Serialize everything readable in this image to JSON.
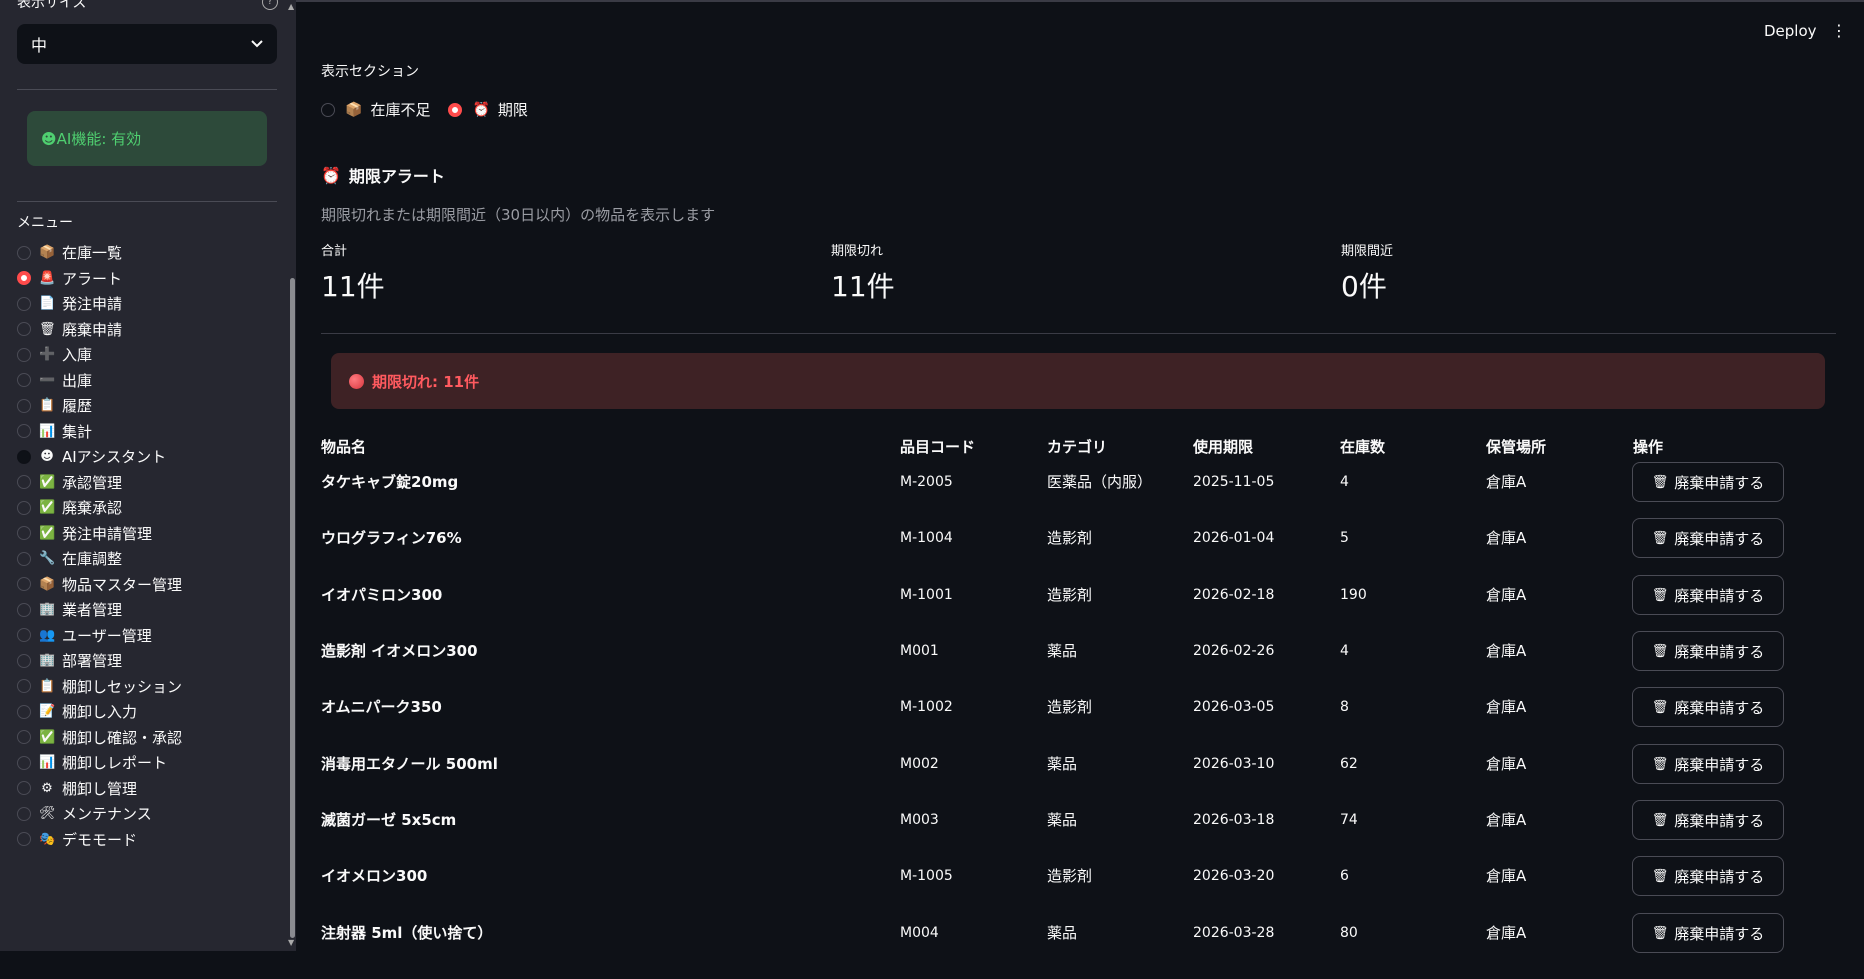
{
  "sidebar": {
    "size_label": "表示サイズ",
    "help_icon": "help-circle-icon",
    "size_select": {
      "value": "中",
      "icon": "chevron-down-icon"
    },
    "ai_status": "☻AI機能: 有効",
    "menu_label": "メニュー",
    "items": [
      {
        "icon": "📦",
        "label": "在庫一覧",
        "selected": false
      },
      {
        "icon": "🚨",
        "label": "アラート",
        "selected": true
      },
      {
        "icon": "📄",
        "label": "発注申請",
        "selected": false
      },
      {
        "icon": "🗑",
        "label": "廃棄申請",
        "selected": false
      },
      {
        "icon": "➕",
        "label": "入庫",
        "selected": false
      },
      {
        "icon": "➖",
        "label": "出庫",
        "selected": false
      },
      {
        "icon": "📋",
        "label": "履歴",
        "selected": false
      },
      {
        "icon": "📊",
        "label": "集計",
        "selected": false
      },
      {
        "icon": "☻",
        "label": "AIアシスタント",
        "selected": false
      },
      {
        "icon": "✅",
        "label": "承認管理",
        "selected": false
      },
      {
        "icon": "✅",
        "label": "廃棄承認",
        "selected": false
      },
      {
        "icon": "✅",
        "label": "発注申請管理",
        "selected": false
      },
      {
        "icon": "🔧",
        "label": "在庫調整",
        "selected": false
      },
      {
        "icon": "📦",
        "label": "物品マスター管理",
        "selected": false
      },
      {
        "icon": "🏢",
        "label": "業者管理",
        "selected": false
      },
      {
        "icon": "👥",
        "label": "ユーザー管理",
        "selected": false
      },
      {
        "icon": "🏢",
        "label": "部署管理",
        "selected": false
      },
      {
        "icon": "📋",
        "label": "棚卸しセッション",
        "selected": false
      },
      {
        "icon": "📝",
        "label": "棚卸し入力",
        "selected": false
      },
      {
        "icon": "✅",
        "label": "棚卸し確認・承認",
        "selected": false
      },
      {
        "icon": "📊",
        "label": "棚卸しレポート",
        "selected": false
      },
      {
        "icon": "⚙",
        "label": "棚卸し管理",
        "selected": false
      },
      {
        "icon": "🛠",
        "label": "メンテナンス",
        "selected": false
      },
      {
        "icon": "🎭",
        "label": "デモモード",
        "selected": false
      }
    ]
  },
  "header": {
    "deploy_label": "Deploy",
    "menu_icon": "more-vertical-icon"
  },
  "section_selector": {
    "label": "表示セクション",
    "options": [
      {
        "icon": "📦",
        "label": "在庫不足",
        "selected": false
      },
      {
        "icon": "⏰",
        "label": "期限",
        "selected": true
      }
    ]
  },
  "expiry": {
    "title_icon": "⏰",
    "title": "期限アラート",
    "subtitle": "期限切れまたは期限間近（30日以内）の物品を表示します",
    "metrics": [
      {
        "label": "合計",
        "value": "11件"
      },
      {
        "label": "期限切れ",
        "value": "11件"
      },
      {
        "label": "期限間近",
        "value": "0件"
      }
    ],
    "alert": "期限切れ: 11件",
    "table": {
      "headers": [
        "物品名",
        "品目コード",
        "カテゴリ",
        "使用期限",
        "在庫数",
        "保管場所",
        "操作"
      ],
      "button_label": "廃棄申請する",
      "button_icon": "🗑",
      "rows": [
        {
          "name": "タケキャブ錠20mg",
          "code": "M-2005",
          "category": "医薬品（内服）",
          "expiry": "2025-11-05",
          "qty": "4",
          "location": "倉庫A"
        },
        {
          "name": "ウログラフィン76%",
          "code": "M-1004",
          "category": "造影剤",
          "expiry": "2026-01-04",
          "qty": "5",
          "location": "倉庫A"
        },
        {
          "name": "イオパミロン300",
          "code": "M-1001",
          "category": "造影剤",
          "expiry": "2026-02-18",
          "qty": "190",
          "location": "倉庫A"
        },
        {
          "name": "造影剤 イオメロン300",
          "code": "M001",
          "category": "薬品",
          "expiry": "2026-02-26",
          "qty": "4",
          "location": "倉庫A"
        },
        {
          "name": "オムニパーク350",
          "code": "M-1002",
          "category": "造影剤",
          "expiry": "2026-03-05",
          "qty": "8",
          "location": "倉庫A"
        },
        {
          "name": "消毒用エタノール 500ml",
          "code": "M002",
          "category": "薬品",
          "expiry": "2026-03-10",
          "qty": "62",
          "location": "倉庫A"
        },
        {
          "name": "滅菌ガーゼ 5x5cm",
          "code": "M003",
          "category": "薬品",
          "expiry": "2026-03-18",
          "qty": "74",
          "location": "倉庫A"
        },
        {
          "name": "イオメロン300",
          "code": "M-1005",
          "category": "造影剤",
          "expiry": "2026-03-20",
          "qty": "6",
          "location": "倉庫A"
        },
        {
          "name": "注射器 5ml（使い捨て）",
          "code": "M004",
          "category": "薬品",
          "expiry": "2026-03-28",
          "qty": "80",
          "location": "倉庫A"
        }
      ]
    }
  }
}
